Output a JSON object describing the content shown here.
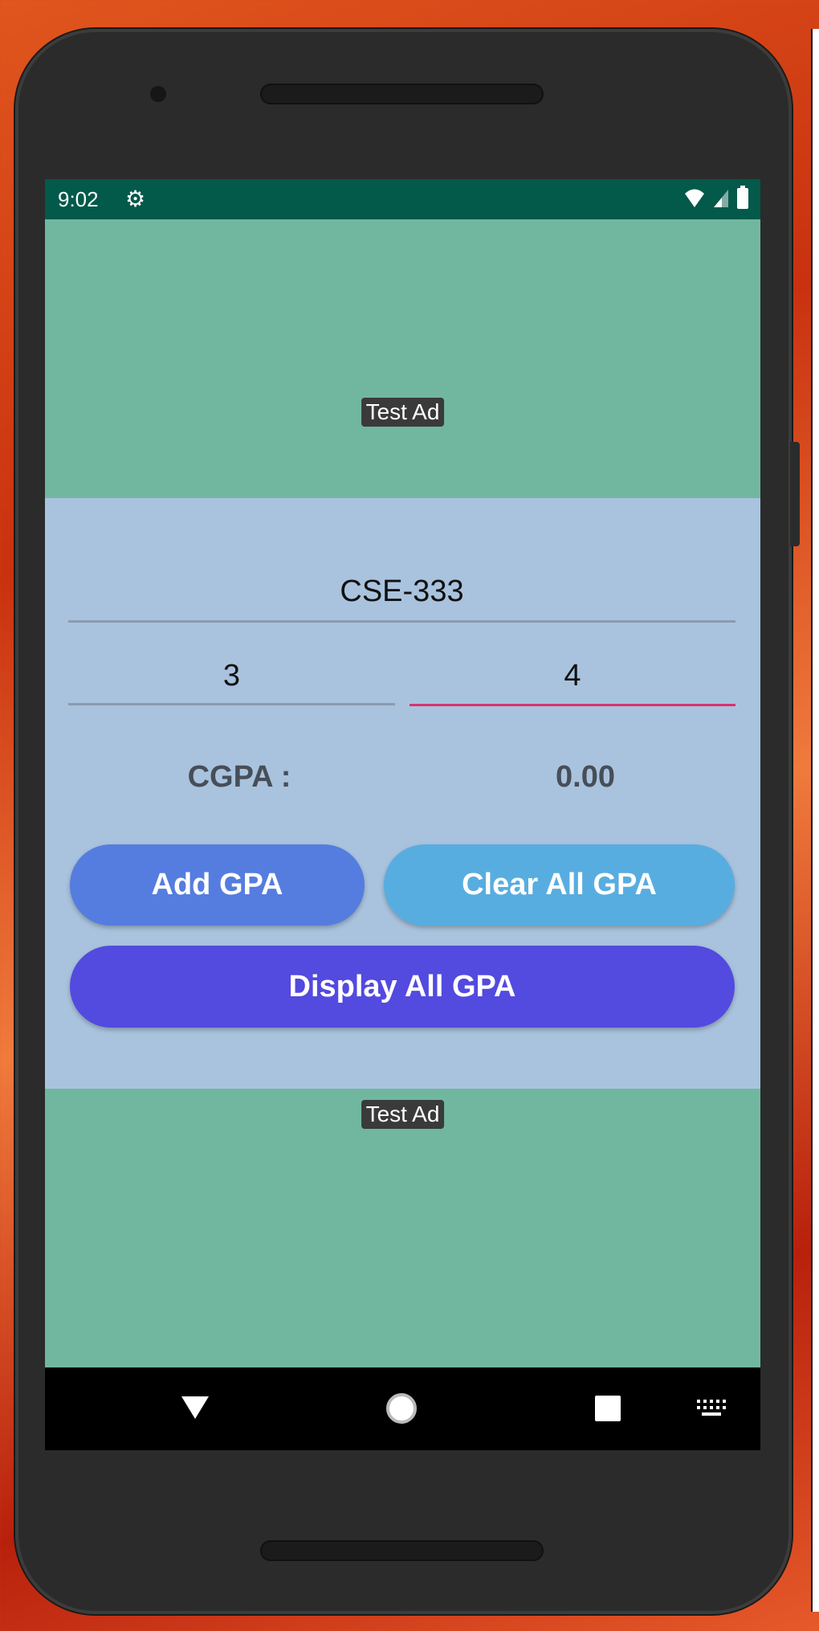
{
  "status_bar": {
    "time": "9:02",
    "icons": [
      "settings-gear-icon",
      "wifi-icon",
      "signal-icon",
      "battery-icon"
    ]
  },
  "ads": {
    "top_label": "Test Ad",
    "bottom_label": "Test Ad"
  },
  "form": {
    "course_value": "CSE-333",
    "credit_value": "3",
    "grade_value": "4",
    "cgpa_label": "CGPA :",
    "cgpa_value": "0.00"
  },
  "buttons": {
    "add": "Add GPA",
    "clear": "Clear All GPA",
    "display": "Display All GPA"
  },
  "colors": {
    "status_bar": "#03594a",
    "ad_bg": "#71b7a0",
    "content_bg": "#a9c3de",
    "add": "#557ddf",
    "clear": "#58ade0",
    "display": "#534adf",
    "focus_underline": "#d6336e"
  },
  "nav_bar": {
    "icons": [
      "back-icon",
      "home-icon",
      "recents-icon",
      "keyboard-icon"
    ]
  }
}
